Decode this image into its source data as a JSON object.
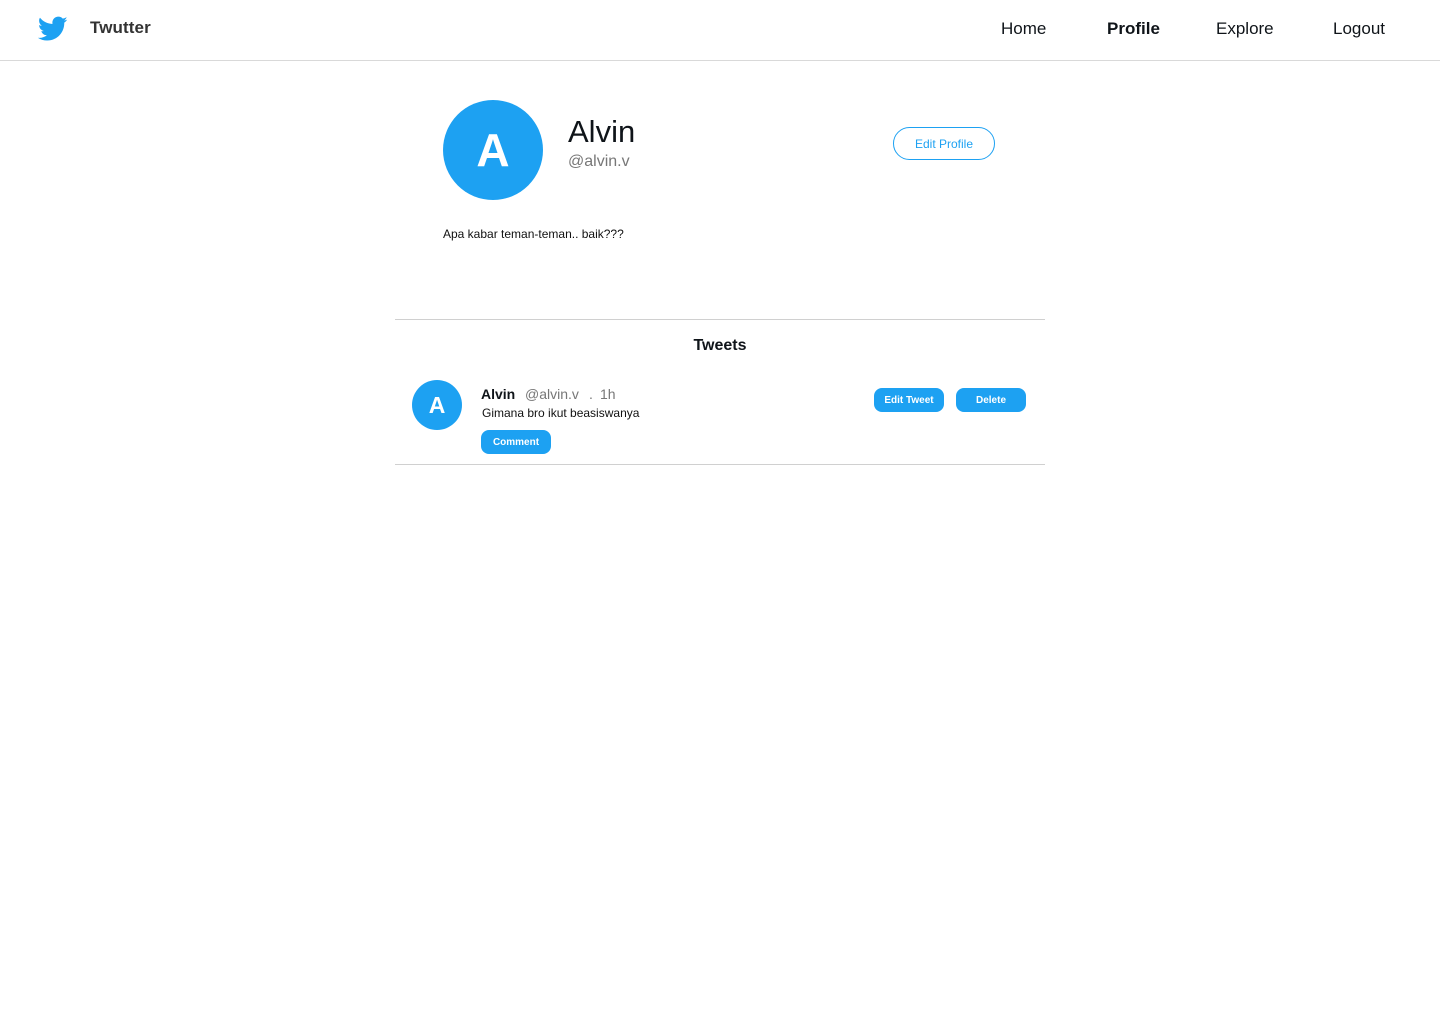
{
  "nav": {
    "brand": "Twutter",
    "links": {
      "home": "Home",
      "profile": "Profile",
      "explore": "Explore",
      "logout": "Logout"
    },
    "active": "Profile"
  },
  "profile": {
    "avatar_initial": "A",
    "name": "Alvin",
    "handle": "@alvin.v",
    "edit_label": "Edit Profile",
    "bio": "Apa kabar teman-teman.. baik???"
  },
  "tweets_section": {
    "heading": "Tweets",
    "items": [
      {
        "avatar_initial": "A",
        "name": "Alvin",
        "handle": "@alvin.v",
        "separator": ".",
        "time": "1h",
        "text": "Gimana bro ikut beasiswanya",
        "comment_label": "Comment",
        "edit_label": "Edit Tweet",
        "delete_label": "Delete"
      }
    ]
  },
  "colors": {
    "accent": "#1da1f2",
    "divider": "#d0d0d0"
  },
  "icons": {
    "logo": "twitter-bird-icon"
  }
}
